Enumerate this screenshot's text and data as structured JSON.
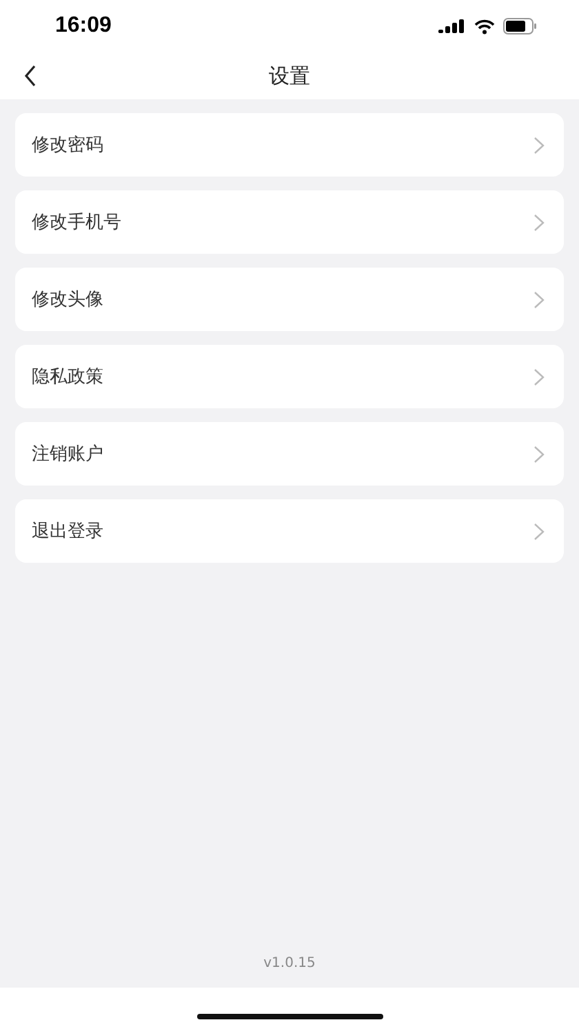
{
  "status_bar": {
    "time": "16:09"
  },
  "nav": {
    "title": "设置"
  },
  "items": [
    {
      "label": "修改密码"
    },
    {
      "label": "修改手机号"
    },
    {
      "label": "修改头像"
    },
    {
      "label": "隐私政策"
    },
    {
      "label": "注销账户"
    },
    {
      "label": "退出登录"
    }
  ],
  "version": "v1.0.15"
}
